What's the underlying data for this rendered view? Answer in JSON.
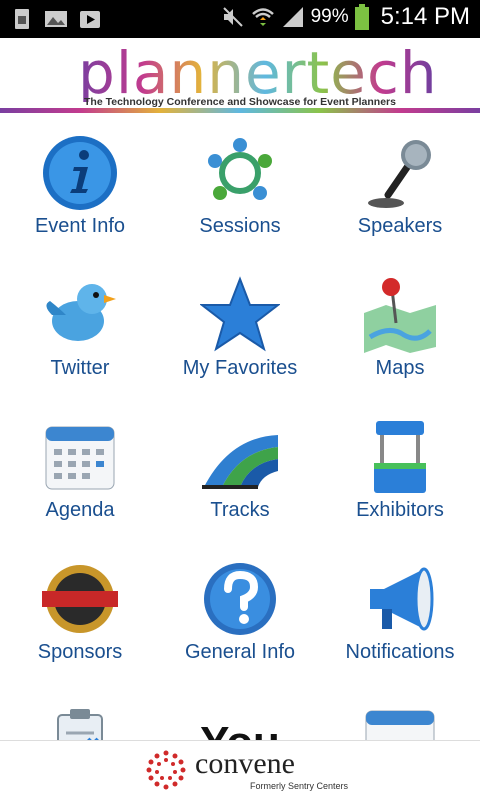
{
  "status_bar": {
    "battery_percent": "99%",
    "time": "5:14 PM",
    "icons": [
      "sim-icon",
      "image-icon",
      "play-store-icon",
      "mute-icon",
      "wifi-icon",
      "signal-icon",
      "battery-icon"
    ]
  },
  "header": {
    "logo_text": "plannertech",
    "tagline": "The Technology Conference and Showcase for Event Planners"
  },
  "tiles": [
    {
      "label": "Event Info",
      "icon": "info-icon"
    },
    {
      "label": "Sessions",
      "icon": "people-circle-icon"
    },
    {
      "label": "Speakers",
      "icon": "microphone-icon"
    },
    {
      "label": "Twitter",
      "icon": "bird-icon"
    },
    {
      "label": "My Favorites",
      "icon": "star-icon"
    },
    {
      "label": "Maps",
      "icon": "map-pin-icon"
    },
    {
      "label": "Agenda",
      "icon": "calendar-icon"
    },
    {
      "label": "Tracks",
      "icon": "tracks-icon"
    },
    {
      "label": "Exhibitors",
      "icon": "booth-icon"
    },
    {
      "label": "Sponsors",
      "icon": "medal-icon"
    },
    {
      "label": "General Info",
      "icon": "question-icon"
    },
    {
      "label": "Notifications",
      "icon": "megaphone-icon"
    },
    {
      "label": "",
      "icon": "clipboard-icon"
    },
    {
      "label": "",
      "icon": "youtube-icon"
    },
    {
      "label": "",
      "icon": "calendar-icon"
    }
  ],
  "youtube_text": "You",
  "footer": {
    "brand": "convene",
    "subtitle": "Formerly Sentry Centers"
  },
  "colors": {
    "label_blue": "#1a4f8f",
    "status_bar_bg": "#000000"
  }
}
